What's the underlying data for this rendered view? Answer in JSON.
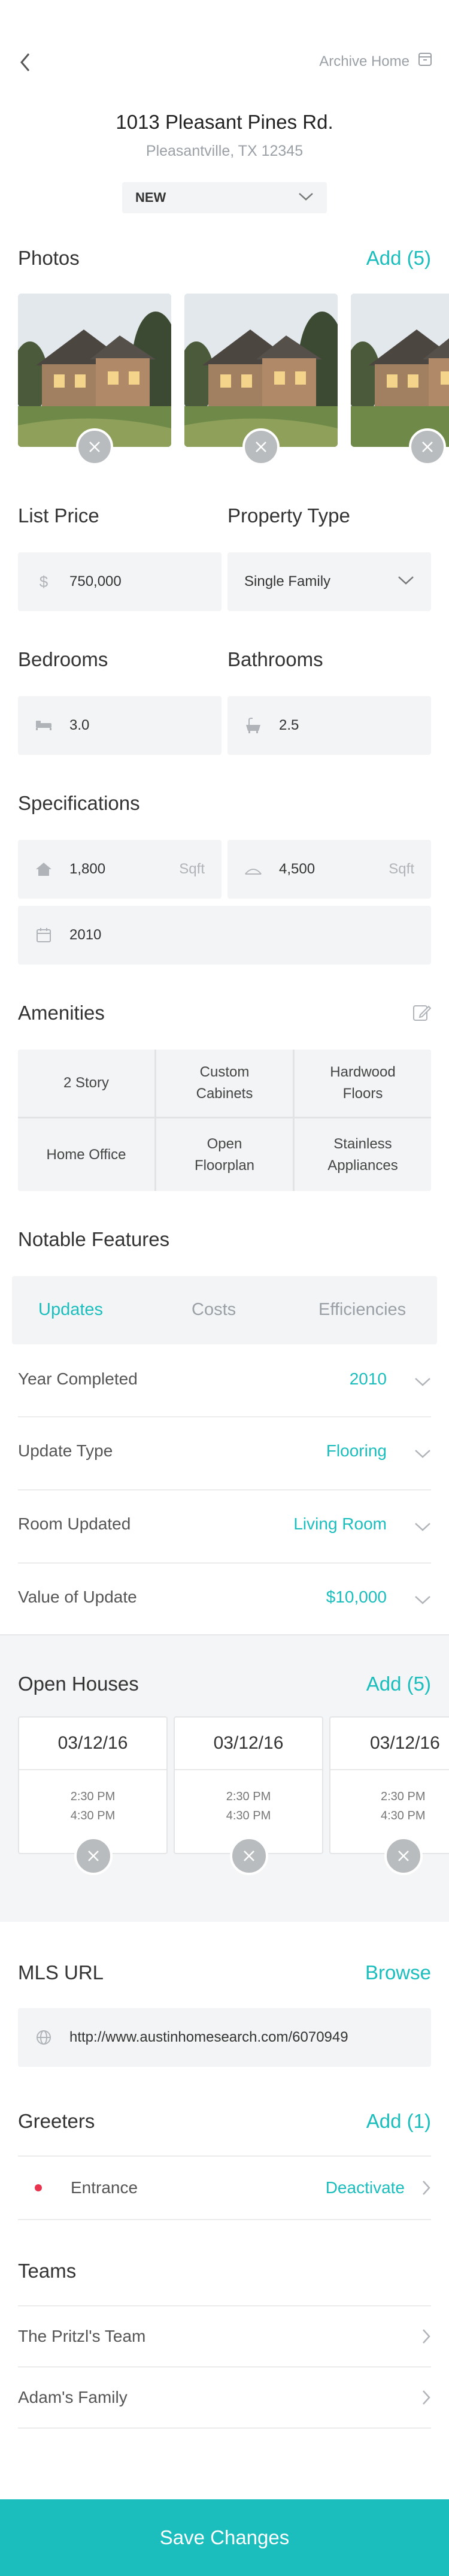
{
  "header": {
    "archive_label": "Archive Home",
    "address": "1013 Pleasant Pines Rd.",
    "city_state": "Pleasantville, TX 12345",
    "status": "NEW"
  },
  "photos": {
    "title": "Photos",
    "add_label": "Add (5)"
  },
  "price": {
    "label": "List Price",
    "currency_symbol": "$",
    "value": "750,000"
  },
  "property_type": {
    "label": "Property Type",
    "value": "Single Family"
  },
  "bedrooms": {
    "label": "Bedrooms",
    "value": "3.0"
  },
  "bathrooms": {
    "label": "Bathrooms",
    "value": "2.5"
  },
  "specifications": {
    "title": "Specifications",
    "home_sqft": "1,800",
    "lot_sqft": "4,500",
    "unit": "Sqft",
    "year": "2010"
  },
  "amenities": {
    "title": "Amenities",
    "items": [
      "2 Story",
      "Custom\nCabinets",
      "Hardwood\nFloors",
      "Home Office",
      "Open\nFloorplan",
      "Stainless\nAppliances"
    ]
  },
  "notable": {
    "title": "Notable Features",
    "tabs": [
      "Updates",
      "Costs",
      "Efficiencies"
    ],
    "active_tab": "Updates",
    "rows": [
      {
        "label": "Year Completed",
        "value": "2010"
      },
      {
        "label": "Update Type",
        "value": "Flooring"
      },
      {
        "label": "Room Updated",
        "value": "Living Room"
      },
      {
        "label": "Value of Update",
        "value": "$10,000"
      }
    ]
  },
  "open_houses": {
    "title": "Open Houses",
    "add_label": "Add (5)",
    "cards": [
      {
        "date": "03/12/16",
        "time": "2:30 PM\n4:30 PM"
      },
      {
        "date": "03/12/16",
        "time": "2:30 PM\n4:30 PM"
      },
      {
        "date": "03/12/16",
        "time": "2:30 PM\n4:30 PM"
      }
    ]
  },
  "mls": {
    "title": "MLS URL",
    "browse_label": "Browse",
    "url": "http://www.austinhomesearch.com/6070949"
  },
  "greeters": {
    "title": "Greeters",
    "add_label": "Add (1)",
    "items": [
      {
        "name": "Entrance",
        "action": "Deactivate"
      }
    ]
  },
  "teams": {
    "title": "Teams",
    "items": [
      "The Pritzl's Team",
      "Adam's Family"
    ]
  },
  "footer": {
    "save_label": "Save Changes"
  },
  "colors": {
    "accent": "#1bbdbd",
    "field_bg": "#f3f4f5",
    "greeter_dot": "#e8344e"
  }
}
